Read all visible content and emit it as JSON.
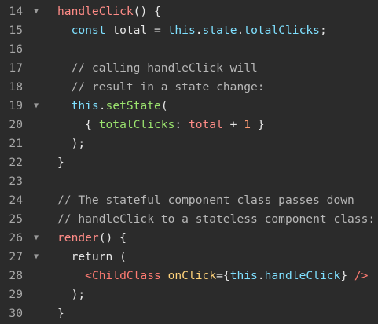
{
  "editor": {
    "fold_marker": "▼",
    "lines": [
      {
        "number": "14",
        "foldable": true,
        "tokens": [
          {
            "t": "handleClick",
            "c": "fn"
          },
          {
            "t": "() {",
            "c": "punc"
          }
        ]
      },
      {
        "number": "15",
        "foldable": false,
        "tokens": [
          {
            "t": "  ",
            "c": "punc"
          },
          {
            "t": "const",
            "c": "kw"
          },
          {
            "t": " total = ",
            "c": "var"
          },
          {
            "t": "this",
            "c": "kw"
          },
          {
            "t": ".",
            "c": "punc"
          },
          {
            "t": "state",
            "c": "kw"
          },
          {
            "t": ".",
            "c": "punc"
          },
          {
            "t": "totalClicks",
            "c": "kw"
          },
          {
            "t": ";",
            "c": "punc"
          }
        ]
      },
      {
        "number": "16",
        "foldable": false,
        "tokens": []
      },
      {
        "number": "17",
        "foldable": false,
        "tokens": [
          {
            "t": "  // calling handleClick will",
            "c": "cmt"
          }
        ]
      },
      {
        "number": "18",
        "foldable": false,
        "tokens": [
          {
            "t": "  // result in a state change:",
            "c": "cmt"
          }
        ]
      },
      {
        "number": "19",
        "foldable": true,
        "tokens": [
          {
            "t": "  ",
            "c": "punc"
          },
          {
            "t": "this",
            "c": "kw"
          },
          {
            "t": ".",
            "c": "punc"
          },
          {
            "t": "setState",
            "c": "prop"
          },
          {
            "t": "(",
            "c": "punc"
          }
        ]
      },
      {
        "number": "20",
        "foldable": false,
        "tokens": [
          {
            "t": "    { ",
            "c": "punc"
          },
          {
            "t": "totalClicks",
            "c": "prop"
          },
          {
            "t": ": ",
            "c": "punc"
          },
          {
            "t": "total",
            "c": "fn"
          },
          {
            "t": " + ",
            "c": "punc"
          },
          {
            "t": "1",
            "c": "num"
          },
          {
            "t": " }",
            "c": "punc"
          }
        ]
      },
      {
        "number": "21",
        "foldable": false,
        "tokens": [
          {
            "t": "  );",
            "c": "punc"
          }
        ]
      },
      {
        "number": "22",
        "foldable": false,
        "tokens": [
          {
            "t": "}",
            "c": "punc"
          }
        ]
      },
      {
        "number": "23",
        "foldable": false,
        "tokens": []
      },
      {
        "number": "24",
        "foldable": false,
        "tokens": [
          {
            "t": "// The stateful component class passes down",
            "c": "cmt"
          }
        ]
      },
      {
        "number": "25",
        "foldable": false,
        "tokens": [
          {
            "t": "// handleClick to a stateless component class:",
            "c": "cmt"
          }
        ]
      },
      {
        "number": "26",
        "foldable": true,
        "tokens": [
          {
            "t": "render",
            "c": "fn"
          },
          {
            "t": "() {",
            "c": "punc"
          }
        ]
      },
      {
        "number": "27",
        "foldable": true,
        "tokens": [
          {
            "t": "  return (",
            "c": "punc"
          }
        ]
      },
      {
        "number": "28",
        "foldable": false,
        "tokens": [
          {
            "t": "    ",
            "c": "punc"
          },
          {
            "t": "<ChildClass",
            "c": "tag"
          },
          {
            "t": " ",
            "c": "punc"
          },
          {
            "t": "onClick",
            "c": "attr"
          },
          {
            "t": "={",
            "c": "punc"
          },
          {
            "t": "this",
            "c": "kw"
          },
          {
            "t": ".",
            "c": "punc"
          },
          {
            "t": "handleClick",
            "c": "kw"
          },
          {
            "t": "} ",
            "c": "punc"
          },
          {
            "t": "/>",
            "c": "tag"
          }
        ]
      },
      {
        "number": "29",
        "foldable": false,
        "tokens": [
          {
            "t": "  );",
            "c": "punc"
          }
        ]
      },
      {
        "number": "30",
        "foldable": false,
        "tokens": [
          {
            "t": "}",
            "c": "punc"
          }
        ]
      }
    ]
  },
  "colors": {
    "background": "#2b2b2b",
    "line_number": "#a8a8a8",
    "function": "#ff8c87",
    "keyword": "#7fe0ff",
    "property": "#9be36e",
    "comment": "#b7b7b7",
    "number": "#ff9b73",
    "jsx_tag": "#ff7b72",
    "jsx_attribute": "#ffd27a"
  }
}
